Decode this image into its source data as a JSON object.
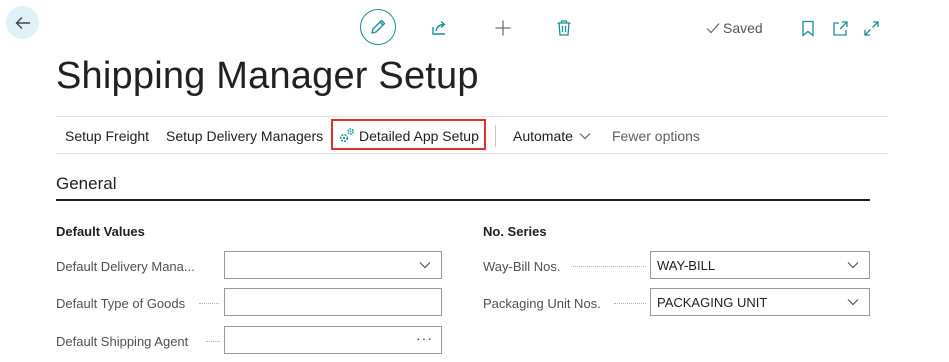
{
  "toolbar": {
    "back_icon": "arrow-left-icon",
    "edit_icon": "pencil-icon",
    "share_icon": "share-icon",
    "new_icon": "plus-icon",
    "delete_icon": "trash-icon",
    "saved_label": "Saved",
    "bookmark_icon": "bookmark-icon",
    "open_new_window_icon": "open-in-new-window-icon",
    "expand_icon": "expand-icon"
  },
  "page": {
    "title": "Shipping Manager Setup"
  },
  "actions": {
    "setup_freight": "Setup Freight",
    "setup_delivery_managers": "Setup Delivery Managers",
    "detailed_app_setup": "Detailed App Setup",
    "automate": "Automate",
    "fewer_options": "Fewer options"
  },
  "general": {
    "title": "General",
    "default_values": {
      "heading": "Default Values",
      "delivery_manager_label": "Default Delivery Mana...",
      "delivery_manager_value": "",
      "type_of_goods_label": "Default Type of Goods",
      "type_of_goods_value": "",
      "shipping_agent_label": "Default Shipping Agent",
      "shipping_agent_value": ""
    },
    "no_series": {
      "heading": "No. Series",
      "way_bill_label": "Way-Bill Nos.",
      "way_bill_value": "WAY-BILL",
      "packaging_unit_label": "Packaging Unit Nos.",
      "packaging_unit_value": "PACKAGING UNIT"
    }
  },
  "colors": {
    "accent": "#1a8f96",
    "highlight_border": "#e0312f",
    "back_button_bg": "#dff1f7"
  }
}
